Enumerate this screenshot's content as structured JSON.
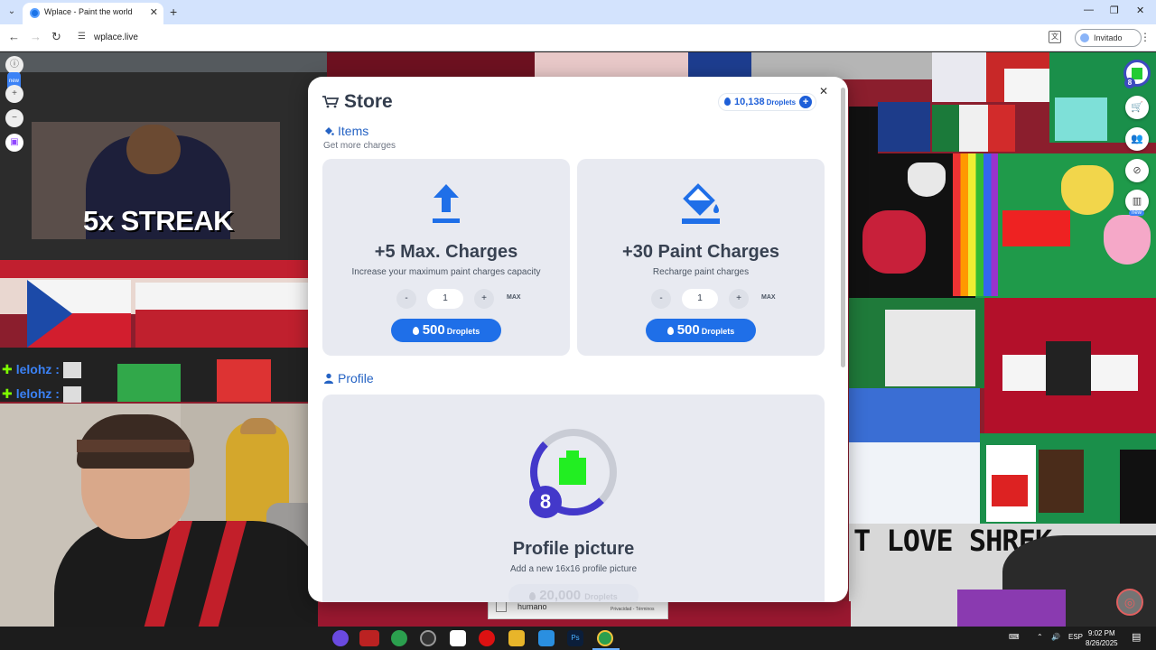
{
  "browser": {
    "tab_title": "Wplace - Paint the world",
    "url": "wplace.live",
    "profile_label": "Invitado"
  },
  "canvas": {
    "streak_text": "5x STREAK",
    "chat_lines": [
      {
        "user": "lelohz",
        "sep": ":"
      },
      {
        "user": "lelohz",
        "sep": ":"
      }
    ],
    "shrek_text": "T LOVE SHREK",
    "captcha_label": "humano",
    "captcha_links": "Privacidad - Términos",
    "player_level": "8"
  },
  "store": {
    "title": "Store",
    "balance": "10,138",
    "balance_unit": "Droplets",
    "items_section": {
      "title": "Items",
      "subtitle": "Get more charges"
    },
    "items": [
      {
        "title": "+5 Max. Charges",
        "description": "Increase your maximum paint charges capacity",
        "quantity": "1",
        "minus": "-",
        "plus": "+",
        "max": "MAX",
        "price": "500",
        "price_unit": "Droplets",
        "icon": "upload-arrow-icon"
      },
      {
        "title": "+30 Paint Charges",
        "description": "Recharge paint charges",
        "quantity": "1",
        "minus": "-",
        "plus": "+",
        "max": "MAX",
        "price": "500",
        "price_unit": "Droplets",
        "icon": "paint-bucket-icon"
      }
    ],
    "profile_section": {
      "title": "Profile"
    },
    "profile_item": {
      "title": "Profile picture",
      "description": "Add a new 16x16 profile picture",
      "price": "20,000",
      "price_unit": "Droplets",
      "level": "8"
    }
  },
  "taskbar": {
    "language": "ESP",
    "time": "9:02 PM",
    "date": "8/26/2025"
  },
  "colors": {
    "accent": "#1f6fe8",
    "card_bg": "#e8eaf1",
    "title_text": "#374151",
    "level_ring": "#4338ca"
  }
}
